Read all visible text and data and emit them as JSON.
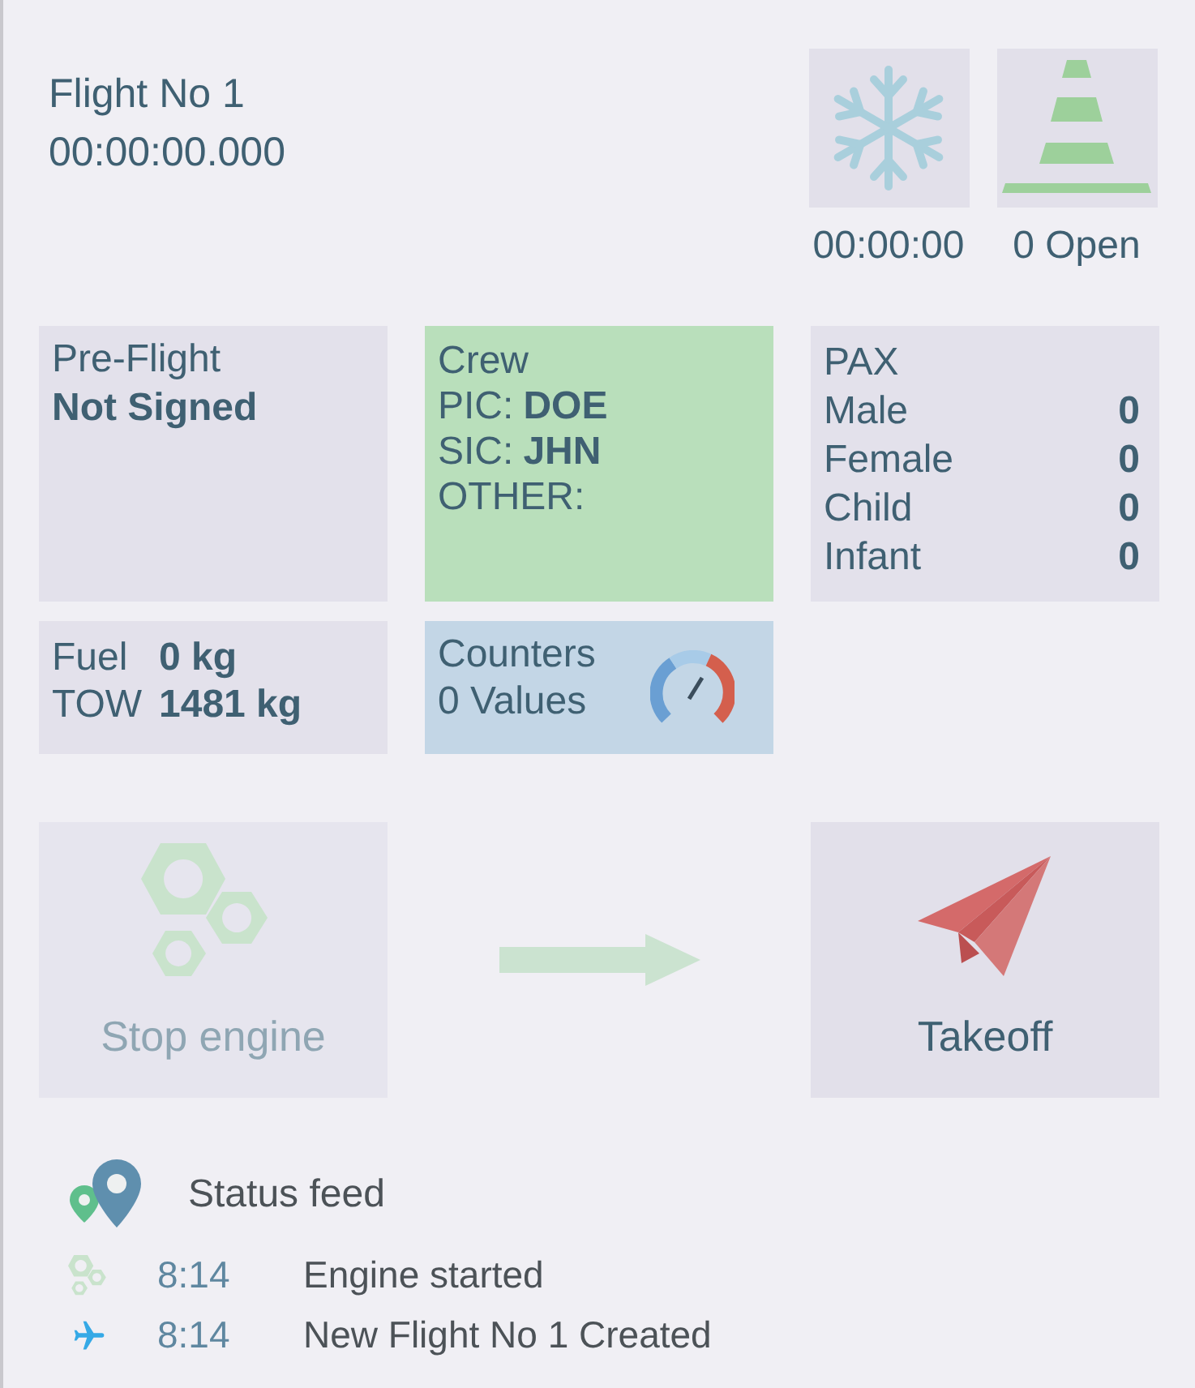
{
  "flight": {
    "title": "Flight No 1",
    "timer": "00:00:00.000"
  },
  "status_tiles": [
    {
      "kind": "deicing",
      "label": "00:00:00"
    },
    {
      "kind": "cones",
      "label": "0 Open"
    }
  ],
  "preflight": {
    "title": "Pre-Flight",
    "status": "Not Signed"
  },
  "crew": {
    "title": "Crew",
    "members": [
      {
        "role": "PIC:",
        "name": "DOE"
      },
      {
        "role": "SIC:",
        "name": "JHN"
      },
      {
        "role": "OTHER:"
      }
    ]
  },
  "pax": {
    "title": "PAX",
    "rows": [
      {
        "label": "Male",
        "count": "0"
      },
      {
        "label": "Female",
        "count": "0"
      },
      {
        "label": "Child",
        "count": "0"
      },
      {
        "label": "Infant",
        "count": "0"
      }
    ]
  },
  "fuel": [
    {
      "label": "Fuel",
      "value": "0 kg"
    },
    {
      "label": "TOW",
      "value": "1481 kg"
    }
  ],
  "counters": {
    "title": "Counters",
    "value": "0 Values"
  },
  "actions": [
    {
      "kind": "engine",
      "label": "Stop engine",
      "disabled": true
    },
    {
      "kind": "takeoff",
      "label": "Takeoff",
      "disabled": false
    }
  ],
  "status_feed": {
    "title": "Status feed",
    "items": [
      {
        "kind": "engine",
        "time": "8:14",
        "text": "Engine started"
      },
      {
        "kind": "flight",
        "time": "8:14",
        "text": "New Flight No 1 Created"
      }
    ]
  }
}
